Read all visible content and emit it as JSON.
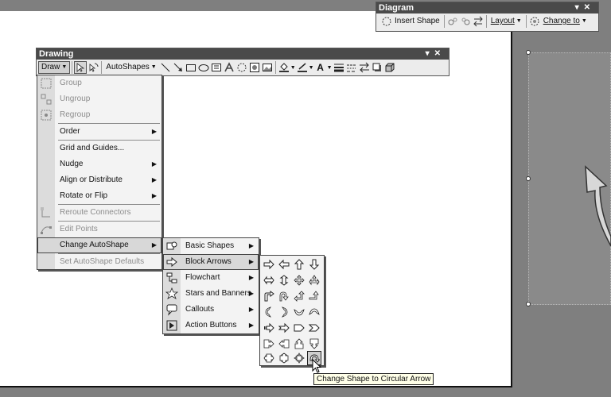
{
  "diagram_toolbar": {
    "title": "Diagram",
    "insert_shape": "Insert Shape",
    "layout": "Layout",
    "change_to": "Change to"
  },
  "drawing_toolbar": {
    "title": "Drawing",
    "draw": "Draw",
    "autoshapes": "AutoShapes"
  },
  "draw_menu": {
    "items": [
      {
        "label": "Group",
        "disabled": true
      },
      {
        "label": "Ungroup",
        "disabled": true
      },
      {
        "label": "Regroup",
        "disabled": true
      },
      {
        "label": "Order",
        "disabled": false
      },
      {
        "label": "Grid and Guides...",
        "disabled": false
      },
      {
        "label": "Nudge",
        "disabled": false
      },
      {
        "label": "Align or Distribute",
        "disabled": false
      },
      {
        "label": "Rotate or Flip",
        "disabled": false
      },
      {
        "label": "Reroute Connectors",
        "disabled": true
      },
      {
        "label": "Edit Points",
        "disabled": true
      },
      {
        "label": "Change AutoShape",
        "disabled": false
      },
      {
        "label": "Set AutoShape Defaults",
        "disabled": true
      }
    ]
  },
  "autoshape_menu": {
    "items": [
      {
        "label": "Basic Shapes"
      },
      {
        "label": "Block Arrows"
      },
      {
        "label": "Flowchart"
      },
      {
        "label": "Stars and Banners"
      },
      {
        "label": "Callouts"
      },
      {
        "label": "Action Buttons"
      }
    ]
  },
  "tooltip": "Change Shape to Circular Arrow",
  "icons": {
    "pointer": "arrow-pointer-icon",
    "free-rotate": "free-rotate-icon",
    "line": "line-icon",
    "arrow": "arrow-line-icon",
    "rectangle": "rectangle-icon",
    "oval": "oval-icon",
    "textbox": "textbox-icon",
    "wordart": "wordart-icon",
    "diagram": "diagram-icon",
    "clipart": "clipart-icon",
    "picture": "picture-icon",
    "fill-color": "fill-color-icon",
    "line-color": "line-color-icon",
    "font-color": "font-color-icon",
    "line-style": "line-style-icon",
    "dash-style": "dash-style-icon",
    "arrow-style": "arrow-style-icon",
    "shadow": "shadow-icon",
    "3d": "3d-style-icon"
  }
}
